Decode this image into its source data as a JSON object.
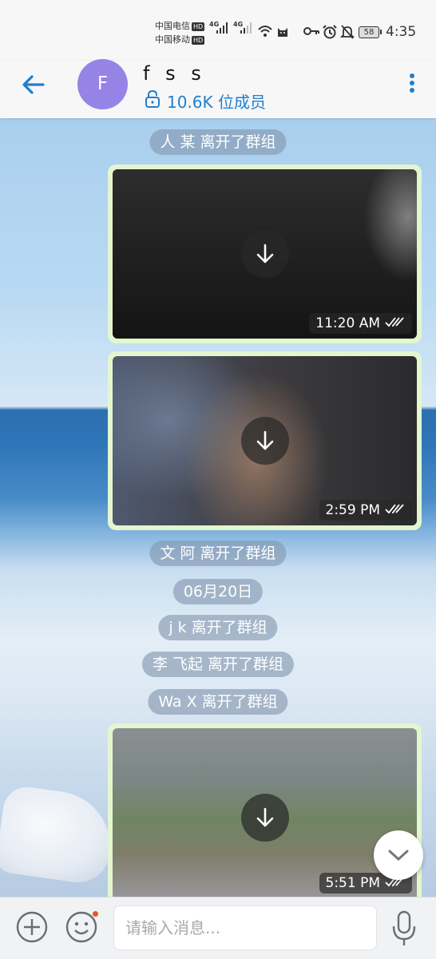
{
  "status_bar": {
    "carrier1": "中国电信",
    "carrier2": "中国移动",
    "hd": "HD",
    "net1": "4G",
    "net2": "4G",
    "battery": "58",
    "time": "4:35"
  },
  "header": {
    "avatar_letter": "F",
    "title": "f s s",
    "members": "10.6K 位成员"
  },
  "messages": {
    "event1": "人 某 离开了群组",
    "media1_time": "11:20 AM",
    "media2_time": "2:59 PM",
    "event2": "文 阿 离开了群组",
    "date": "06月20日",
    "event3": "j k 离开了群组",
    "event4": "李 飞起 离开了群组",
    "event5": "Wa X 离开了群组",
    "media3_time": "5:51 PM"
  },
  "input": {
    "placeholder": "请输入消息..."
  },
  "colors": {
    "accent": "#1f7ed0",
    "avatar": "#9584e6",
    "bubble": "#e3f6cf"
  }
}
